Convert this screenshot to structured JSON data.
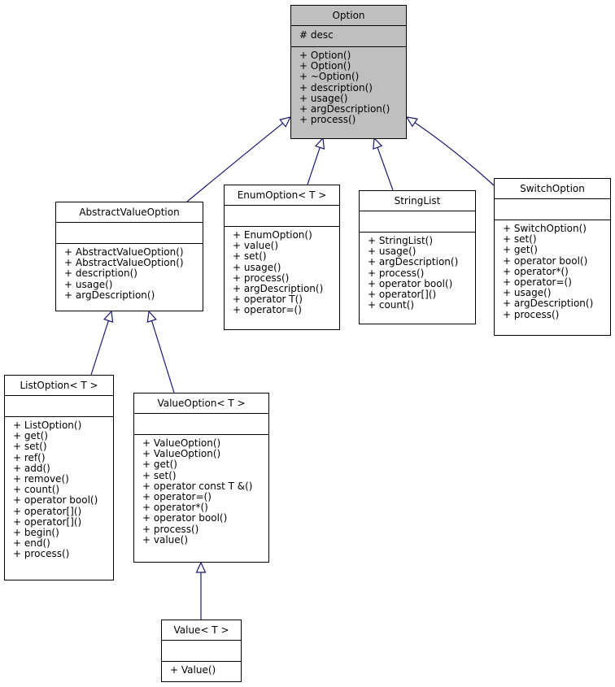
{
  "diagram": {
    "type": "UML class inheritance diagram",
    "edge_color": "#191970",
    "base_fill": "#bfbfbf",
    "classes": {
      "option": {
        "name": "Option",
        "attributes": [
          "# desc"
        ],
        "operations": [
          "+ Option()",
          "+ Option()",
          "+ ~Option()",
          "+ description()",
          "+ usage()",
          "+ argDescription()",
          "+ process()"
        ]
      },
      "abstract_value_option": {
        "name": "AbstractValueOption",
        "attributes": [],
        "operations": [
          "+ AbstractValueOption()",
          "+ AbstractValueOption()",
          "+ description()",
          "+ usage()",
          "+ argDescription()"
        ]
      },
      "enum_option": {
        "name": "EnumOption< T >",
        "attributes": [],
        "operations": [
          "+ EnumOption()",
          "+ value()",
          "+ set()",
          "+ usage()",
          "+ process()",
          "+ argDescription()",
          "+ operator T()",
          "+ operator=()"
        ]
      },
      "string_list": {
        "name": "StringList",
        "attributes": [],
        "operations": [
          "+ StringList()",
          "+ usage()",
          "+ argDescription()",
          "+ process()",
          "+ operator bool()",
          "+ operator[]()",
          "+ count()"
        ]
      },
      "switch_option": {
        "name": "SwitchOption",
        "attributes": [],
        "operations": [
          "+ SwitchOption()",
          "+ set()",
          "+ get()",
          "+ operator bool()",
          "+ operator*()",
          "+ operator=()",
          "+ usage()",
          "+ argDescription()",
          "+ process()"
        ]
      },
      "list_option": {
        "name": "ListOption< T >",
        "attributes": [],
        "operations": [
          "+ ListOption()",
          "+ get()",
          "+ set()",
          "+ ref()",
          "+ add()",
          "+ remove()",
          "+ count()",
          "+ operator bool()",
          "+ operator[]()",
          "+ operator[]()",
          "+ begin()",
          "+ end()",
          "+ process()"
        ]
      },
      "value_option": {
        "name": "ValueOption< T >",
        "attributes": [],
        "operations": [
          "+ ValueOption()",
          "+ ValueOption()",
          "+ get()",
          "+ set()",
          "+ operator const T &()",
          "+ operator=()",
          "+ operator*()",
          "+ operator bool()",
          "+ process()",
          "+ value()"
        ]
      },
      "value": {
        "name": "Value< T >",
        "attributes": [],
        "operations": [
          "+ Value()"
        ]
      }
    },
    "inheritance": [
      {
        "child": "abstract_value_option",
        "parent": "option"
      },
      {
        "child": "enum_option",
        "parent": "option"
      },
      {
        "child": "string_list",
        "parent": "option"
      },
      {
        "child": "switch_option",
        "parent": "option"
      },
      {
        "child": "list_option",
        "parent": "abstract_value_option"
      },
      {
        "child": "value_option",
        "parent": "abstract_value_option"
      },
      {
        "child": "value",
        "parent": "value_option"
      }
    ]
  }
}
